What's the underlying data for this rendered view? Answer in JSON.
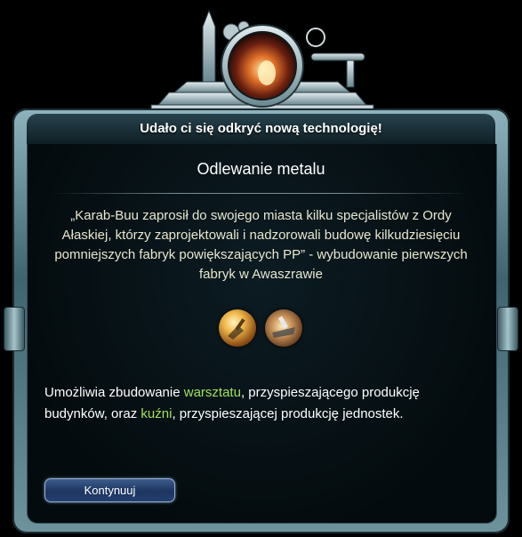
{
  "dialog": {
    "title": "Udało ci się odkryć nową technologię!",
    "tech_name": "Odlewanie metalu",
    "quote": "„Karab-Buu zaprosił do swojego miasta kilku specjalistów z Ordy Ałaskiej, którzy zaprojektowali i nadzorowali budowę kilkudziesięciu pomniejszych fabryk powiększających PP” - wybudowanie pierwszych fabryk w Awaszrawie",
    "unlocks": {
      "part1": "Umożliwia zbudowanie ",
      "building1": "warsztatu",
      "part2": ", przyspieszającego produkcję budynków, oraz ",
      "building2": "kuźni",
      "part3": ", przyspieszającej produkcję jednostek."
    },
    "continue_label": "Kontynuuj"
  },
  "icons": [
    "foundry-emblem-icon",
    "workshop-icon",
    "forge-icon"
  ],
  "colors": {
    "highlight": "#9fe35b",
    "button": "#1d3560",
    "frame": "#6e939d"
  }
}
